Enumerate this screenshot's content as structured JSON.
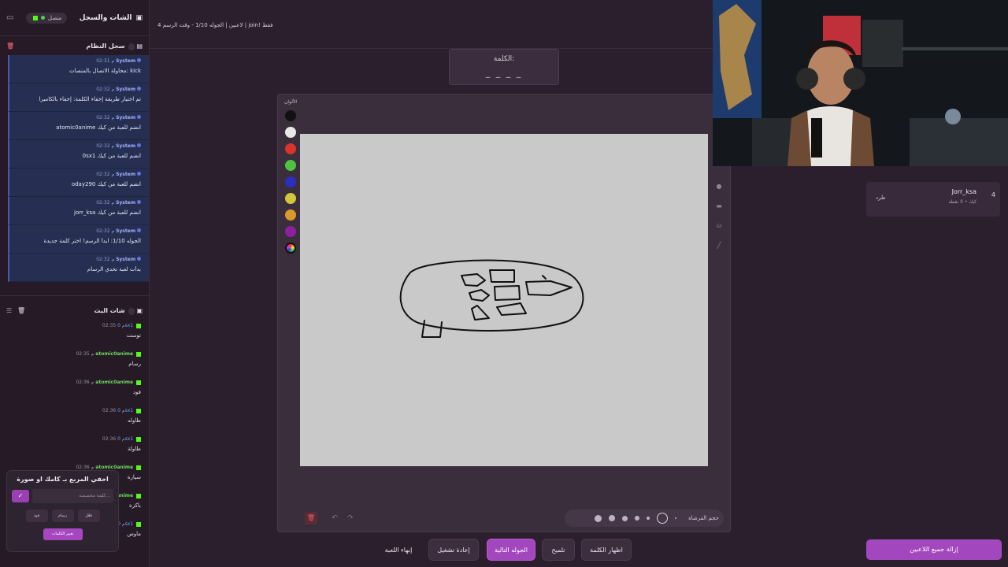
{
  "sidebar": {
    "title": "الشات والسجل",
    "connection": "متصل",
    "system_log_title": "سجل النظام",
    "system_log_count": "",
    "system_messages": [
      {
        "sender": "System",
        "time": "02:31 م",
        "text": "محاولة الاتصال بالمنصات: kick"
      },
      {
        "sender": "System",
        "time": "02:32 م",
        "text": "تم اختيار طريقة إخفاء الكلمة: إخفاء بالكاميرا"
      },
      {
        "sender": "System",
        "time": "02:32 م",
        "text": "atomic0anime انضم للعبة من كيك"
      },
      {
        "sender": "System",
        "time": "02:32 م",
        "text": "0sx1 انضم للعبة من كيك"
      },
      {
        "sender": "System",
        "time": "02:32 م",
        "text": "oday290 انضم للعبة من كيك"
      },
      {
        "sender": "System",
        "time": "02:32 م",
        "text": "jorr_ksa انضم للعبة من كيك"
      },
      {
        "sender": "System",
        "time": "02:32 م",
        "text": "الجوله 1/10: ابدأ الرسم! اختر كلمة جديدة"
      },
      {
        "sender": "System",
        "time": "02:32 م",
        "text": "بدأت لعبة تحدي الرسام"
      }
    ],
    "live_chat_title": "شات البث",
    "live_chat_count": "",
    "chat_messages": [
      {
        "user": "0sx1",
        "time": "02:35 م",
        "text": "توست",
        "kind": "u1"
      },
      {
        "user": "atomic0anime",
        "time": "02:35 م",
        "text": "رسام",
        "kind": "u2"
      },
      {
        "user": "atomic0anime",
        "time": "02:36 م",
        "text": "فود",
        "kind": "u2"
      },
      {
        "user": "0sx1",
        "time": "02:36 م",
        "text": "طاوله",
        "kind": "u1"
      },
      {
        "user": "0sx1",
        "time": "02:36 م",
        "text": "طاولة",
        "kind": "u1"
      },
      {
        "user": "atomic0anime",
        "time": "02:36 م",
        "text": "سيارة",
        "kind": "u2"
      },
      {
        "user": "atomic0anime",
        "time": "02:36 م",
        "text": "باكرة",
        "kind": "u2"
      },
      {
        "user": "0sx1",
        "time": "02:37 م",
        "text": "ماوس",
        "kind": "u1"
      }
    ]
  },
  "popup": {
    "title": "اخفي المربع بـ كامك او صورة",
    "input_placeholder": "كلمة مخصصة...",
    "check": "✓",
    "btn_1": "فعّل",
    "btn_2": "رسام",
    "btn_3": "فود",
    "change_words": "تغيير الكلمات"
  },
  "topbar": {
    "info": "4 لاعبين | الجوله 1/10 - وقت الرسم | join! فقط"
  },
  "word": {
    "label": "الكلمة:",
    "blanks": "_ _ _ _"
  },
  "canvas": {
    "palette_label": "الألوان",
    "colors": [
      "#111111",
      "#e8e8e8",
      "#d9342b",
      "#4fc242",
      "#2b2fbf",
      "#d3c63a",
      "#d89a2b",
      "#8e1fa0"
    ],
    "brush_label": "حجم الفرشاة"
  },
  "buttons": {
    "end_game": "إنهاء اللعبة",
    "restart": "إعادة تشغيل",
    "next_round": "الجوله التالية",
    "hint": "تلميح",
    "reveal_word": "اظهار الكلمة"
  },
  "players": {
    "rank": "4",
    "name": "Jorr_ksa",
    "sub": "كيك • 0 نقطة",
    "kick_label": "طرد",
    "remove_all": "إزالة جميع اللاعبين"
  }
}
